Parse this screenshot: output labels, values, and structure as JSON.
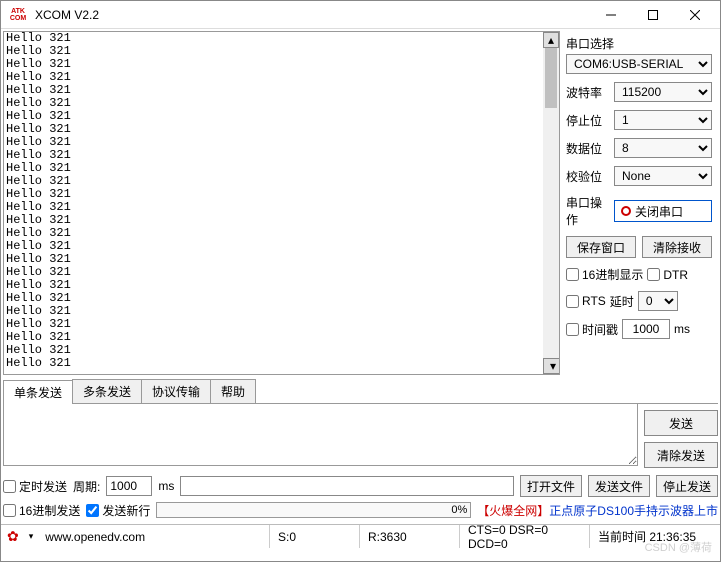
{
  "window": {
    "title": "XCOM V2.2"
  },
  "output_lines": [
    "Hello 321",
    "Hello 321",
    "Hello 321",
    "Hello 321",
    "Hello 321",
    "Hello 321",
    "Hello 321",
    "Hello 321",
    "Hello 321",
    "Hello 321",
    "Hello 321",
    "Hello 321",
    "Hello 321",
    "Hello 321",
    "Hello 321",
    "Hello 321",
    "Hello 321",
    "Hello 321",
    "Hello 321",
    "Hello 321",
    "Hello 321",
    "Hello 321",
    "Hello 321",
    "Hello 321",
    "Hello 321",
    "Hello 321"
  ],
  "side": {
    "group_label": "串口选择",
    "port": "COM6:USB-SERIAL",
    "baud_label": "波特率",
    "baud": "115200",
    "stop_label": "停止位",
    "stop": "1",
    "data_label": "数据位",
    "data": "8",
    "parity_label": "校验位",
    "parity": "None",
    "op_label": "串口操作",
    "op_btn": "关闭串口",
    "save_win": "保存窗口",
    "clear_rx": "清除接收",
    "hex_disp": "16进制显示",
    "dtr": "DTR",
    "rts": "RTS",
    "delay_label": "延时",
    "delay": "0",
    "timestamp": "时间戳",
    "ts_val": "1000",
    "ts_unit": "ms"
  },
  "tabs": [
    "单条发送",
    "多条发送",
    "协议传输",
    "帮助"
  ],
  "send": {
    "send_btn": "发送",
    "clear_btn": "清除发送",
    "timed_send": "定时发送",
    "period_label": "周期:",
    "period": "1000",
    "period_unit": "ms",
    "open_file": "打开文件",
    "send_file": "发送文件",
    "stop_send": "停止发送",
    "hex_send": "16进制发送",
    "send_newline": "发送新行",
    "progress": "0%",
    "link_hot": "【火爆全网】",
    "link_text": "正点原子DS100手持示波器上市"
  },
  "status": {
    "url": "www.openedv.com",
    "s": "S:0",
    "r": "R:3630",
    "sig": "CTS=0 DSR=0 DCD=0",
    "time": "当前时间 21:36:35"
  },
  "watermark": "CSDN @薄荷"
}
